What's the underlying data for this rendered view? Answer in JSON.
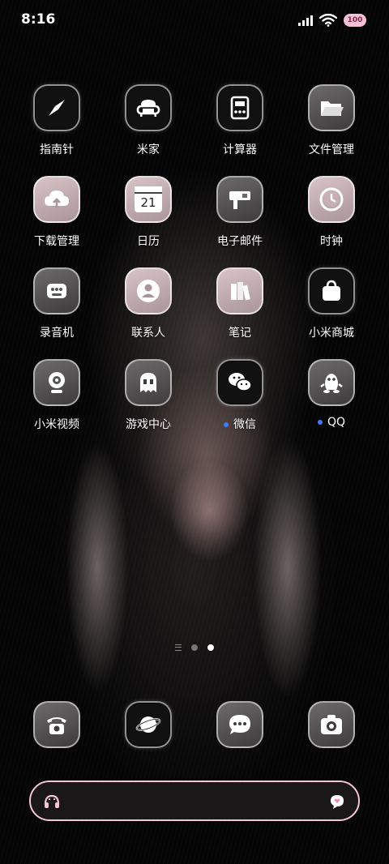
{
  "status_bar": {
    "time": "8:16",
    "battery_level": "100",
    "icons": [
      "signal-icon",
      "wifi-icon",
      "battery-icon"
    ]
  },
  "apps": [
    {
      "label": "指南针",
      "icon": "compass-icon",
      "notification": false
    },
    {
      "label": "米家",
      "icon": "sofa-icon",
      "notification": false
    },
    {
      "label": "计算器",
      "icon": "calculator-icon",
      "notification": false
    },
    {
      "label": "文件管理",
      "icon": "folder-icon",
      "notification": false
    },
    {
      "label": "下载管理",
      "icon": "cloud-upload-icon",
      "notification": false
    },
    {
      "label": "日历",
      "icon": "calendar-icon",
      "notification": false,
      "day": "21"
    },
    {
      "label": "电子邮件",
      "icon": "mailbox-icon",
      "notification": false
    },
    {
      "label": "时钟",
      "icon": "clock-icon",
      "notification": false
    },
    {
      "label": "录音机",
      "icon": "recorder-icon",
      "notification": false
    },
    {
      "label": "联系人",
      "icon": "contact-icon",
      "notification": false
    },
    {
      "label": "笔记",
      "icon": "books-icon",
      "notification": false
    },
    {
      "label": "小米商城",
      "icon": "shopping-bag-icon",
      "notification": false
    },
    {
      "label": "小米视频",
      "icon": "webcam-icon",
      "notification": false
    },
    {
      "label": "游戏中心",
      "icon": "ghost-icon",
      "notification": false
    },
    {
      "label": "微信",
      "icon": "wechat-icon",
      "notification": true
    },
    {
      "label": "QQ",
      "icon": "penguin-icon",
      "notification": true
    }
  ],
  "dock": [
    {
      "icon": "phone-icon"
    },
    {
      "icon": "planet-icon"
    },
    {
      "icon": "message-icon"
    },
    {
      "icon": "camera-icon"
    }
  ],
  "page_indicator": {
    "pages": 2,
    "active_page": 2
  },
  "search_bar": {
    "left_icon": "headphones-icon",
    "right_icon": "heart-bubble-icon"
  },
  "colors": {
    "notification_dot": "#3d7bff",
    "search_border": "#f2c6d7",
    "battery": "#f5c0d6"
  }
}
